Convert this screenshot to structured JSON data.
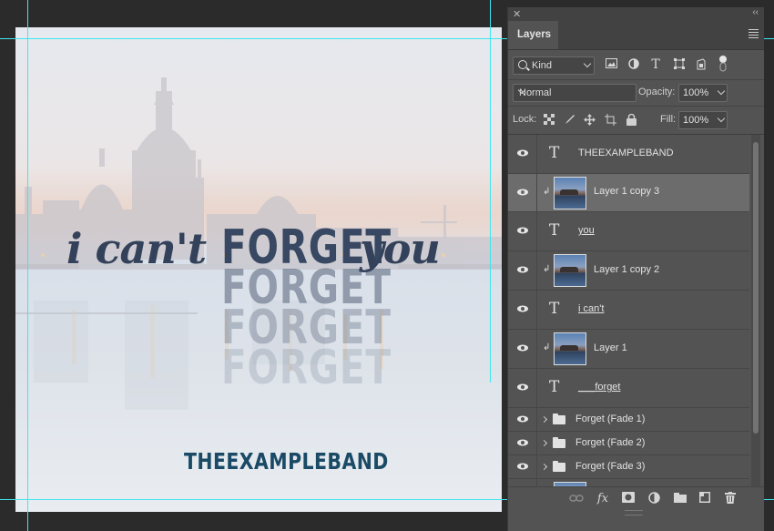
{
  "artwork": {
    "headline_part1": "i can't",
    "headline_forget": "FORGET",
    "headline_part3": "you",
    "fade_text": "FORGET",
    "band_name": "THEEXAMPLEBAND"
  },
  "panel": {
    "title": "Layers",
    "filter_kind": "Kind",
    "blend_mode": "Normal",
    "opacity_label": "Opacity:",
    "opacity_value": "100%",
    "lock_label": "Lock:",
    "fill_label": "Fill:",
    "fill_value": "100%"
  },
  "layers": [
    {
      "type": "text",
      "name": "THEEXAMPLEBAND",
      "underline": false,
      "selected": false
    },
    {
      "type": "image",
      "name": "Layer 1 copy 3",
      "clipped": true,
      "selected": true
    },
    {
      "type": "text",
      "name": "you",
      "underline": true,
      "selected": false
    },
    {
      "type": "image",
      "name": "Layer 1 copy 2",
      "clipped": true,
      "selected": false
    },
    {
      "type": "text",
      "name": "i can't",
      "underline": true,
      "selected": false
    },
    {
      "type": "image",
      "name": "Layer 1",
      "clipped": true,
      "selected": false
    },
    {
      "type": "text",
      "name": "___forget",
      "underline": true,
      "selected": false
    },
    {
      "type": "group",
      "name": "Forget (Fade 1)"
    },
    {
      "type": "group",
      "name": "Forget (Fade 2)"
    },
    {
      "type": "group",
      "name": "Forget (Fade 3)"
    }
  ],
  "icons": {
    "close": "close-icon",
    "collapse": "collapse-icon",
    "menu": "panel-menu-icon"
  },
  "colors": {
    "guide": "#3ee6f0",
    "panel_bg": "#535353",
    "selected_row": "#6c6c6c",
    "band_text": "#1a4a66"
  }
}
